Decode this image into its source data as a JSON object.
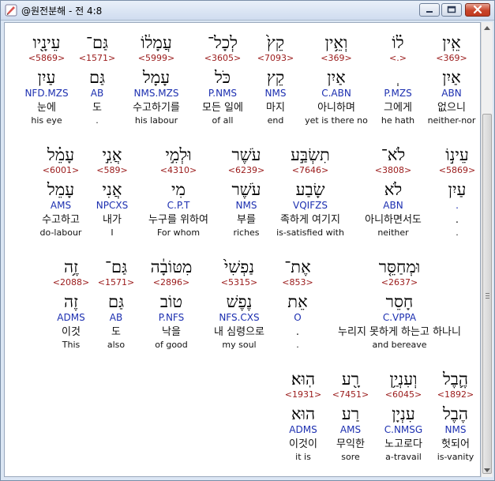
{
  "window": {
    "title": "@원전분해 - 전 4:8",
    "accent_close": "#c8452b"
  },
  "rows": [
    {
      "words": [
        {
          "heb": "אֵֽין",
          "strong": "<369>",
          "lemma": "אַיִן",
          "morph": "ABN",
          "kor": "없으니",
          "eng": "neither-nor"
        },
        {
          "heb": "ל֗וֹ",
          "strong": "<.>",
          "lemma": "ְ",
          "morph": "P.MZS",
          "kor": "그에게",
          "eng": "he hath"
        },
        {
          "heb": "וְאֵ֥ין",
          "strong": "<369>",
          "lemma": "אַיִן",
          "morph": "C.ABN",
          "kor": "아니하며",
          "eng": "yet is there no"
        },
        {
          "heb": "קֵץ֙",
          "strong": "<7093>",
          "lemma": "קֵץ",
          "morph": "NMS",
          "kor": "마지",
          "eng": "end"
        },
        {
          "heb": "לְכָל־",
          "strong": "<3605>",
          "lemma": "כֹּל",
          "morph": "P.NMS",
          "kor": "모든 일에",
          "eng": "of all"
        },
        {
          "heb": "עֲמָל֔וֹ",
          "strong": "<5999>",
          "lemma": "עָמָל",
          "morph": "NMS.MZS",
          "kor": "수고하기를",
          "eng": "his labour"
        },
        {
          "heb": "גַּם־",
          "strong": "<1571>",
          "lemma": "גַּם",
          "morph": "AB",
          "kor": "도",
          "eng": "."
        },
        {
          "heb": "עֵינָ֖יו",
          "strong": "<5869>",
          "lemma": "עַיִן",
          "morph": "NFD.MZS",
          "kor": "눈에",
          "eng": "his eye"
        }
      ]
    },
    {
      "words": [
        {
          "heb": "עֵינ֣וֹ",
          "strong": "<5869>",
          "lemma": "עַיִן",
          "morph": ".",
          "kor": ".",
          "eng": "."
        },
        {
          "heb": "לֹא־",
          "strong": "<3808>",
          "lemma": "לֹא",
          "morph": "ABN",
          "kor": "아니하면서도",
          "eng": "neither"
        },
        {
          "heb": "תִשְׂבַּ֣ע",
          "strong": "<7646>",
          "lemma": "שָׂבַע",
          "morph": "VQIFZS",
          "kor": "족하게 여기지",
          "eng": "is-satisfied with"
        },
        {
          "heb": "עֹשֶׁר",
          "strong": "<6239>",
          "lemma": "עֹשֶׁר",
          "morph": "NMS",
          "kor": "부를",
          "eng": "riches"
        },
        {
          "heb": "וּלְמִ֣י",
          "strong": "<4310>",
          "lemma": "מִי",
          "morph": "C.P.T",
          "kor": "누구를 위하여",
          "eng": "For whom"
        },
        {
          "heb": "אֲנִ֣י",
          "strong": "<589>",
          "lemma": "אֲנִי",
          "morph": "NPCXS",
          "kor": "내가",
          "eng": "I"
        },
        {
          "heb": "עָמֵ֗ל",
          "strong": "<6001>",
          "lemma": "עָמֵל",
          "morph": "AMS",
          "kor": "수고하고",
          "eng": "do-labour"
        }
      ]
    },
    {
      "words": [
        {
          "heb": "וּמְחַסֵּ֤ר",
          "strong": "<2637>",
          "lemma": "חָסֵר",
          "morph": "C.VPPA",
          "kor": "누리지 못하게 하는고 하나니",
          "eng": "and bereave"
        },
        {
          "heb": "אֶת־",
          "strong": "<853>",
          "lemma": "אֵת",
          "morph": "O",
          "kor": ".",
          "eng": "."
        },
        {
          "heb": "נַפְשִׁי֙",
          "strong": "<5315>",
          "lemma": "נֶפֶשׁ",
          "morph": "NFS.CXS",
          "kor": "내 심령으로",
          "eng": "my soul"
        },
        {
          "heb": "מִטּוֹבָ֔ה",
          "strong": "<2896>",
          "lemma": "טוֹב",
          "morph": "P.NFS",
          "kor": "낙을",
          "eng": "of good"
        },
        {
          "heb": "גַּם־",
          "strong": "<1571>",
          "lemma": "גַּם",
          "morph": "AB",
          "kor": "도",
          "eng": "also"
        },
        {
          "heb": "זֶ֥ה",
          "strong": "<2088>",
          "lemma": "זֶה",
          "morph": "ADMS",
          "kor": "이것",
          "eng": "This"
        }
      ]
    },
    {
      "words": [
        {
          "heb": "הֶ֛בֶל",
          "strong": "<1892>",
          "lemma": "הֶבֶל",
          "morph": "NMS",
          "kor": "헛되어",
          "eng": "is-vanity"
        },
        {
          "heb": "וְעִנְיַ֥ן",
          "strong": "<6045>",
          "lemma": "עִנְיָן",
          "morph": "C.NMSG",
          "kor": "노고로다",
          "eng": "a-travail"
        },
        {
          "heb": "רָ֖ע",
          "strong": "<7451>",
          "lemma": "רַע",
          "morph": "AMS",
          "kor": "무익한",
          "eng": "sore"
        },
        {
          "heb": "הֽוּא׃",
          "strong": "<1931>",
          "lemma": "הוּא",
          "morph": "ADMS",
          "kor": "이것이",
          "eng": "it is"
        }
      ]
    }
  ]
}
